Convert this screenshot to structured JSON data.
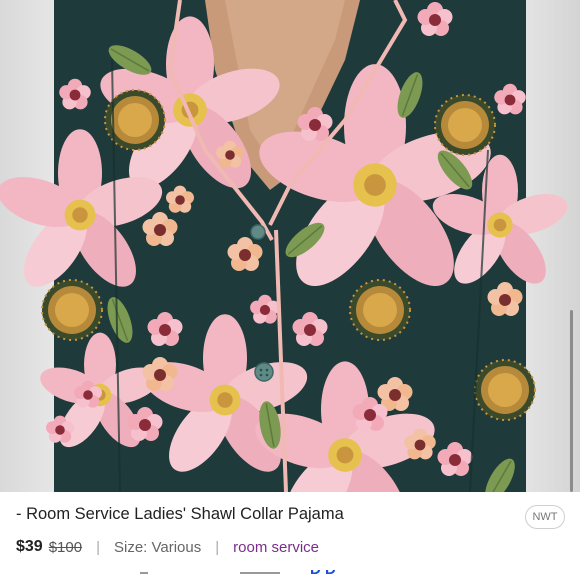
{
  "listing": {
    "title": "- Room Service Ladies' Shawl Collar Pajama",
    "condition_badge": "NWT",
    "price": "$39",
    "original_price": "$100",
    "size": "Size: Various",
    "brand": "room service",
    "separator": "|"
  },
  "image": {
    "subject": "model wearing dark teal floral pajama top with pink piping",
    "colors": {
      "fabric": "#1f3a3a",
      "piping": "#f0b9b3",
      "petal_pink": "#f2b7c2",
      "petal_light": "#f9dde3",
      "flower_center": "#c9953f",
      "leaf": "#7c9a52",
      "skin": "#c89a7a"
    }
  },
  "bottom": {
    "partial_text": "D  D"
  },
  "colors": {
    "accent_link": "#7b2d8b",
    "text": "#222222",
    "muted": "#666666"
  }
}
